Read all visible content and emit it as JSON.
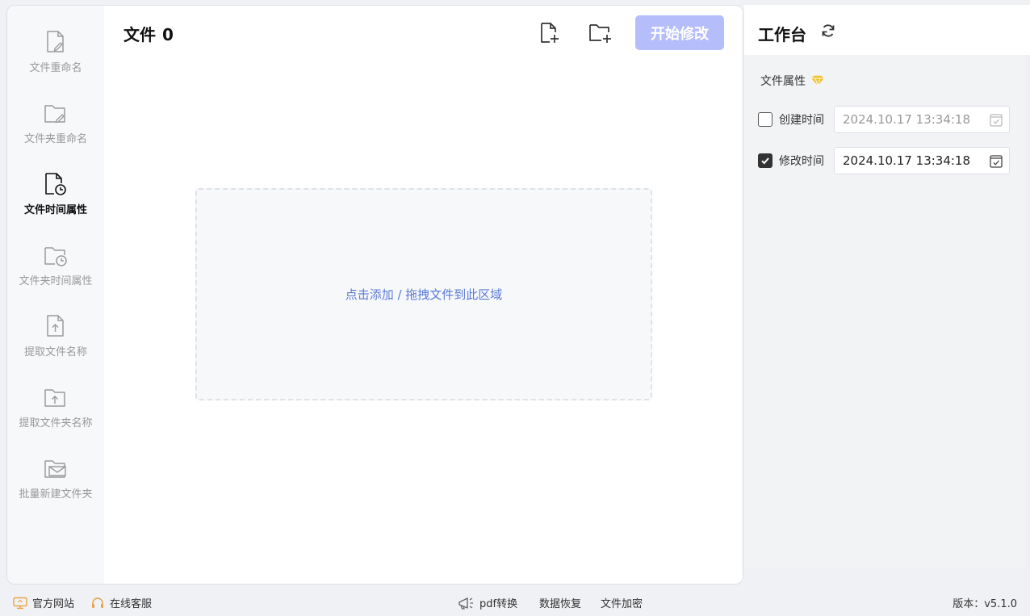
{
  "sidebar": {
    "items": [
      {
        "label": "文件重命名",
        "icon": "file-edit-icon",
        "active": false
      },
      {
        "label": "文件夹重命名",
        "icon": "folder-edit-icon",
        "active": false
      },
      {
        "label": "文件时间属性",
        "icon": "file-clock-icon",
        "active": true
      },
      {
        "label": "文件夹时间属性",
        "icon": "folder-clock-icon",
        "active": false
      },
      {
        "label": "提取文件名称",
        "icon": "file-upload-icon",
        "active": false
      },
      {
        "label": "提取文件夹名称",
        "icon": "folder-upload-icon",
        "active": false
      },
      {
        "label": "批量新建文件夹",
        "icon": "folder-mail-icon",
        "active": false
      }
    ]
  },
  "main": {
    "title": "文件",
    "count": "0",
    "start_button": "开始修改",
    "dropzone_text": "点击添加 / 拖拽文件到此区域"
  },
  "panel": {
    "title": "工作台",
    "section_title": "文件属性",
    "create_time": {
      "label": "创建时间",
      "value": "2024.10.17 13:34:18",
      "checked": false
    },
    "modify_time": {
      "label": "修改时间",
      "value": "2024.10.17 13:34:18",
      "checked": true
    }
  },
  "footer": {
    "website": "官方网站",
    "support": "在线客服",
    "pdf": "pdf转换",
    "recovery": "数据恢复",
    "encrypt": "文件加密",
    "version": "版本：v5.1.0"
  },
  "colors": {
    "accent_button": "#b6bdfb",
    "link_text": "#5a7ad8",
    "gold_icon": "#f2c12e"
  }
}
